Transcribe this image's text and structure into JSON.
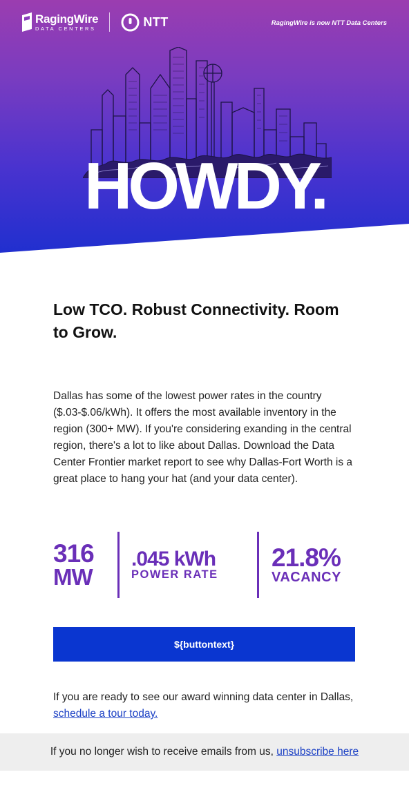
{
  "header": {
    "brand_name": "RagingWire",
    "brand_sub": "DATA CENTERS",
    "partner_name": "NTT",
    "rebrand_note": "RagingWire is now NTT Data Centers"
  },
  "hero": {
    "title": "HOWDY."
  },
  "content": {
    "headline": "Low TCO. Robust Connectivity. Room to Grow.",
    "intro": "Dallas has some of the lowest power rates in the country ($.03-$.06/kWh). It offers the most available inventory in the region (300+ MW). If you're considering exanding in the central region, there's a lot to like about Dallas. Download the Data Center Frontier market report to see why Dallas-Fort Worth is a great place to hang your hat (and your data center)."
  },
  "stats": [
    {
      "value": "316",
      "label": "MW"
    },
    {
      "value": ".045 kWh",
      "label": "POWER RATE"
    },
    {
      "value": "21.8%",
      "label": "VACANCY"
    }
  ],
  "cta": {
    "label": "${buttontext}"
  },
  "tour": {
    "text": "If you are ready to see our award winning data center in Dallas, ",
    "link": "schedule a tour today."
  },
  "footer": {
    "text": "If you no longer wish to receive emails from us, ",
    "link": "unsubscribe here"
  },
  "colors": {
    "accent_purple": "#6a2fb8",
    "cta_blue": "#0a36d0",
    "link_blue": "#1a3fc4",
    "hero_top": "#9b3db0",
    "hero_bottom": "#1f2fcf"
  }
}
